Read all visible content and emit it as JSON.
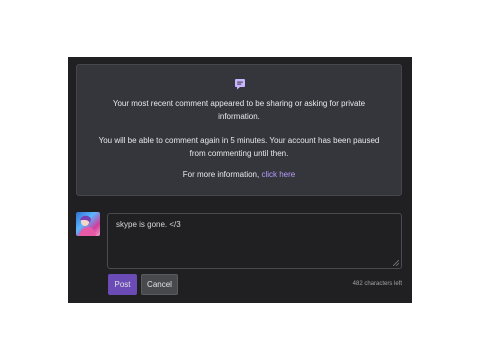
{
  "notice": {
    "icon": "chat-bubble-icon",
    "line1": "Your most recent comment appeared to be sharing or asking for private information.",
    "line2": "You will be able to comment again in 5 minutes. Your account has been paused from commenting until then.",
    "more_prefix": "For more information, ",
    "more_link": "click here"
  },
  "comment": {
    "text": "skype is gone. </3",
    "post_label": "Post",
    "cancel_label": "Cancel",
    "chars_left": "482 characters left"
  },
  "colors": {
    "panel_bg": "#202022",
    "notice_bg": "#35363b",
    "post_button": "#6b4bb5",
    "link": "#b69cff"
  }
}
